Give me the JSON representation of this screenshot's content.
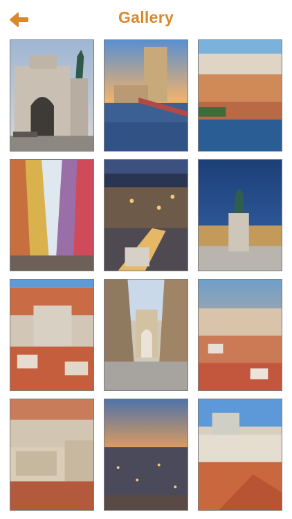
{
  "header": {
    "title": "Gallery",
    "back_icon": "arrow-left-icon",
    "accent_color": "#d9892a"
  },
  "gallery": {
    "items": [
      {
        "id": "photo-1",
        "subject": "triumphal-arch-statue"
      },
      {
        "id": "photo-2",
        "subject": "tower-by-river"
      },
      {
        "id": "photo-3",
        "subject": "hillside-city-river"
      },
      {
        "id": "photo-4",
        "subject": "colorful-street"
      },
      {
        "id": "photo-5",
        "subject": "city-night"
      },
      {
        "id": "photo-6",
        "subject": "square-statue-dusk"
      },
      {
        "id": "photo-7",
        "subject": "rooftops-cathedral"
      },
      {
        "id": "photo-8",
        "subject": "pedestrian-street-arch"
      },
      {
        "id": "photo-9",
        "subject": "city-panorama-sunset"
      },
      {
        "id": "photo-10",
        "subject": "plaza-aerial"
      },
      {
        "id": "photo-11",
        "subject": "city-twilight"
      },
      {
        "id": "photo-12",
        "subject": "castle-rooftops"
      }
    ]
  }
}
